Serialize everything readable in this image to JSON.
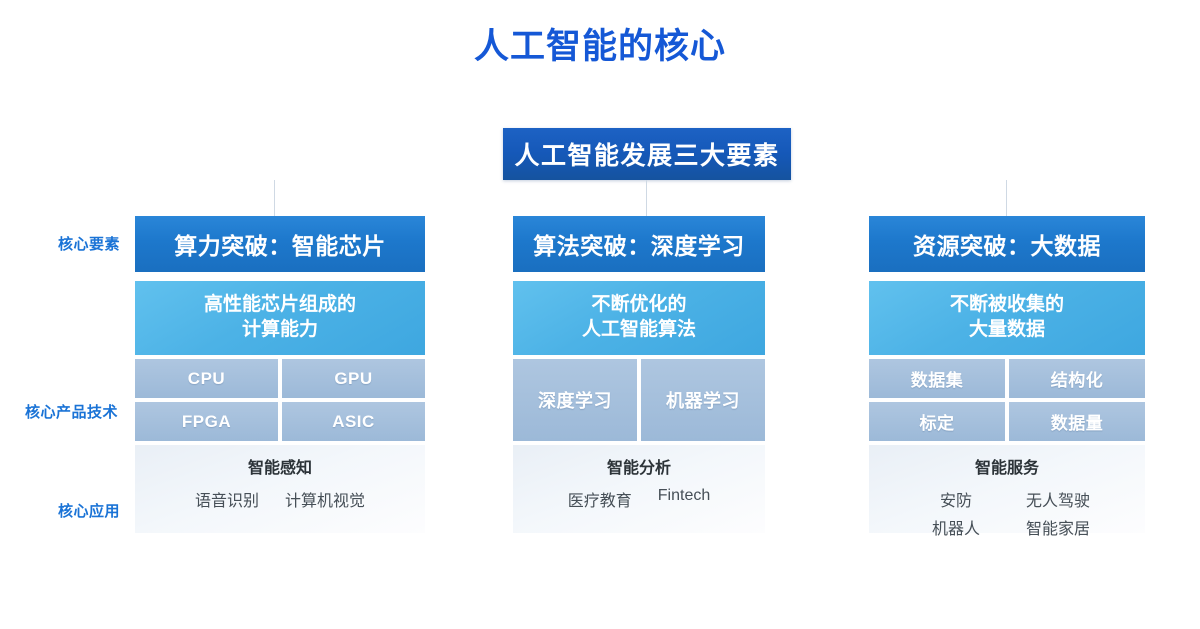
{
  "page_title": "人工智能的核心",
  "banner": {
    "label": "人工智能发展三大要素"
  },
  "colors": {
    "title_blue": "#1558d6",
    "banner_blue": "#1558b8",
    "header_blue": "#1d78cc",
    "desc_blue": "#4cb2e6",
    "chip_blue": "#9cb9d8",
    "app_bg": "#eef3f8",
    "row_label_blue": "#1a73d6"
  },
  "row_labels": [
    {
      "label": "核心要素"
    },
    {
      "label": "核心产品技术"
    },
    {
      "label": "核心应用"
    }
  ],
  "columns": [
    {
      "header": "算力突破：智能芯片",
      "desc_lines": [
        "高性能芯片组成的",
        "计算能力"
      ],
      "tech": [
        "CPU",
        "GPU",
        "FPGA",
        "ASIC"
      ],
      "app_title": "智能感知",
      "app_tags": [
        "语音识别",
        "计算机视觉"
      ]
    },
    {
      "header": "算法突破：深度学习",
      "desc_lines": [
        "不断优化的",
        "人工智能算法"
      ],
      "tech": [
        "深度学习",
        "机器学习"
      ],
      "app_title": "智能分析",
      "app_tags": [
        "医疗教育",
        "Fintech"
      ]
    },
    {
      "header": "资源突破：大数据",
      "desc_lines": [
        "不断被收集的",
        "大量数据"
      ],
      "tech": [
        "数据集",
        "结构化",
        "标定",
        "数据量"
      ],
      "app_title": "智能服务",
      "app_tags": [
        "安防",
        "无人驾驶",
        "机器人",
        "智能家居"
      ]
    }
  ]
}
